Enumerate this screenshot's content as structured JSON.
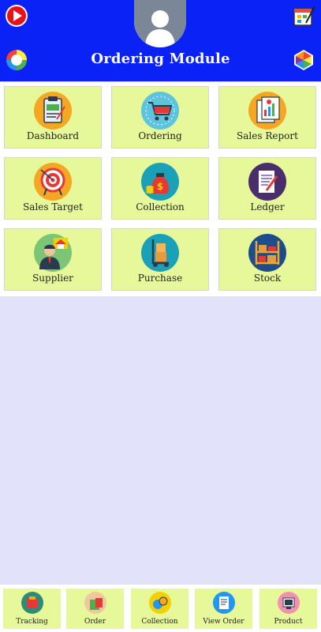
{
  "header": {
    "title": "Ordering Module",
    "bg_color": "#0a22f5",
    "left_top_icon": "youtube-play-icon",
    "right_top_icon": "calendar-edit-icon",
    "left_logo_icon": "colorful-ring-logo-icon",
    "right_logo_icon": "triangle-hexagon-logo-icon",
    "avatar_icon": "user-avatar-icon"
  },
  "modules": [
    {
      "label": "Dashboard",
      "icon": "clipboard-icon"
    },
    {
      "label": "Ordering",
      "icon": "shopping-cart-icon"
    },
    {
      "label": "Sales Report",
      "icon": "report-chart-icon"
    },
    {
      "label": "Sales Target",
      "icon": "target-icon"
    },
    {
      "label": "Collection",
      "icon": "money-bag-icon"
    },
    {
      "label": "Ledger",
      "icon": "document-pen-icon"
    },
    {
      "label": "Supplier",
      "icon": "supplier-person-icon"
    },
    {
      "label": "Purchase",
      "icon": "hand-truck-icon"
    },
    {
      "label": "Stock",
      "icon": "warehouse-shelf-icon"
    }
  ],
  "bottom_nav": [
    {
      "label": "Tracking",
      "icon": "tracking-icon"
    },
    {
      "label": "Order",
      "icon": "shopping-bag-icon"
    },
    {
      "label": "Collection",
      "icon": "coins-icon"
    },
    {
      "label": "View Order",
      "icon": "order-list-icon"
    },
    {
      "label": "Product",
      "icon": "product-box-icon"
    }
  ],
  "colors": {
    "tile_bg": "#e7f89a",
    "page_bg": "#e2e3fb"
  }
}
